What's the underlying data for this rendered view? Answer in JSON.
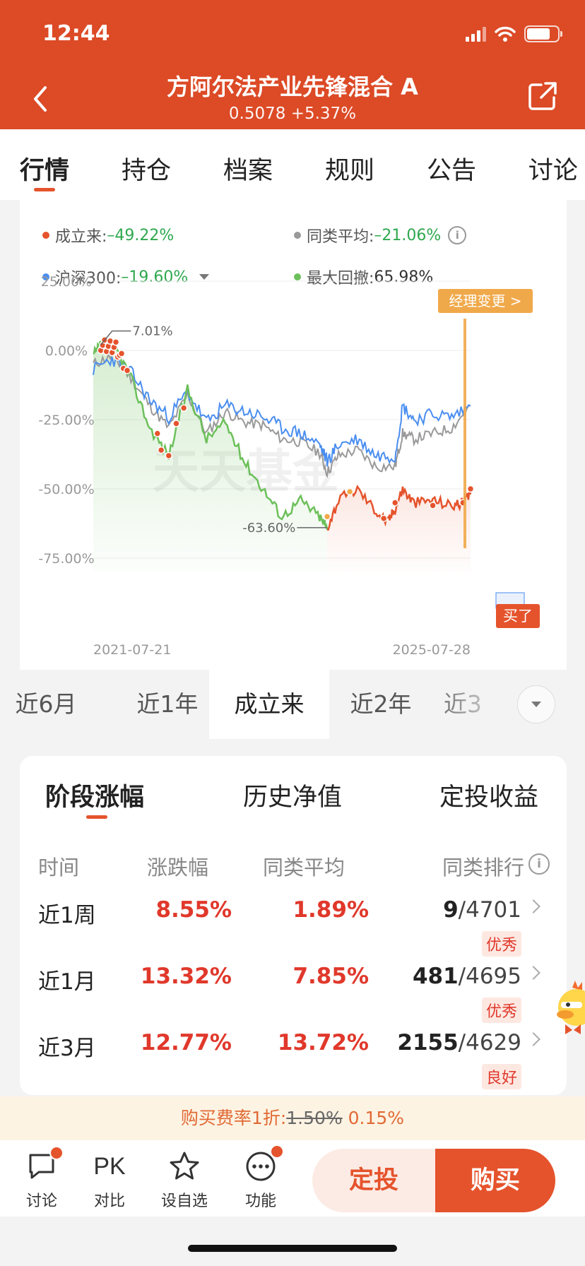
{
  "status_bar": {
    "time": "12:44"
  },
  "header": {
    "title": "方阿尔法产业先锋混合 A",
    "subtitle": "0.5078 +5.37%"
  },
  "tabs": [
    "行情",
    "持仓",
    "档案",
    "规则",
    "公告",
    "讨论"
  ],
  "legend": {
    "fund_label": "成立来:",
    "fund_value": "–49.22%",
    "peer_label": "同类平均:",
    "peer_value": "–21.06%",
    "index_label": "沪深300:",
    "index_value": "–19.60%",
    "drawdown_label": "最大回撤:",
    "drawdown_value": "65.98%",
    "info_icon": "i"
  },
  "colors": {
    "brand": "#dc4a26",
    "fund": "#e5532c",
    "peer": "#999999",
    "index": "#4a8ef0",
    "drawdown": "#6cc05a",
    "manager": "#f0a94a"
  },
  "chart_data": {
    "type": "line",
    "ylim": [
      -75,
      25
    ],
    "yticks": [
      "25.00%",
      "0.00%",
      "-25.00%",
      "-50.00%",
      "-75.00%"
    ],
    "x_range": [
      "2021-07-21",
      "2025-07-28"
    ],
    "series": [
      {
        "name": "成立来",
        "x": [
          0,
          0.02,
          0.06,
          0.1,
          0.15,
          0.2,
          0.25,
          0.3,
          0.35,
          0.4,
          0.45,
          0.5,
          0.55,
          0.6,
          0.62,
          0.65,
          0.7,
          0.75,
          0.78,
          0.8,
          0.82,
          0.85,
          0.9,
          0.95,
          0.98,
          1.0
        ],
        "values": [
          -2,
          2,
          1,
          -10,
          -28,
          -38,
          -14,
          -32,
          -26,
          -40,
          -50,
          -60,
          -54,
          -60,
          -64,
          -54,
          -50,
          -58,
          -62,
          -57,
          -50,
          -55,
          -54,
          -56,
          -55,
          -52
        ]
      },
      {
        "name": "同类平均",
        "x": [
          0,
          0.05,
          0.1,
          0.15,
          0.2,
          0.25,
          0.3,
          0.35,
          0.4,
          0.45,
          0.5,
          0.55,
          0.6,
          0.62,
          0.65,
          0.7,
          0.75,
          0.8,
          0.82,
          0.85,
          0.9,
          0.95,
          1.0
        ],
        "values": [
          -5,
          -2,
          -10,
          -20,
          -28,
          -16,
          -30,
          -22,
          -26,
          -27,
          -32,
          -33,
          -37,
          -44,
          -38,
          -36,
          -42,
          -42,
          -30,
          -32,
          -30,
          -28,
          -20
        ]
      },
      {
        "name": "沪深300",
        "x": [
          0,
          0.05,
          0.1,
          0.15,
          0.2,
          0.25,
          0.3,
          0.35,
          0.4,
          0.45,
          0.5,
          0.55,
          0.6,
          0.62,
          0.65,
          0.7,
          0.75,
          0.8,
          0.82,
          0.85,
          0.9,
          0.95,
          1.0
        ],
        "values": [
          -7,
          -3,
          -8,
          -18,
          -24,
          -15,
          -26,
          -20,
          -22,
          -24,
          -28,
          -30,
          -34,
          -40,
          -34,
          -32,
          -38,
          -38,
          -20,
          -25,
          -23,
          -24,
          -20
        ]
      }
    ],
    "annotations": [
      {
        "label": "7.01%",
        "series": "成立来"
      },
      {
        "label": "-63.60%",
        "series": "成立来"
      }
    ],
    "manager_tag": "经理变更 >",
    "buy_tag": "买了",
    "watermark": "天天基金"
  },
  "periods": [
    "近6月",
    "近1年",
    "成立来",
    "近2年",
    "近3"
  ],
  "returns": {
    "sub_tabs": [
      "阶段涨幅",
      "历史净值",
      "定投收益"
    ],
    "headers": [
      "时间",
      "涨跌幅",
      "同类平均",
      "同类排行"
    ],
    "rows": [
      {
        "period": "近1周",
        "change": "8.55%",
        "avg": "1.89%",
        "rank": "9",
        "total": "/4701",
        "badge": "优秀"
      },
      {
        "period": "近1月",
        "change": "13.32%",
        "avg": "7.85%",
        "rank": "481",
        "total": "/4695",
        "badge": "优秀"
      },
      {
        "period": "近3月",
        "change": "12.77%",
        "avg": "13.72%",
        "rank": "2155",
        "total": "/4629",
        "badge": "良好"
      }
    ]
  },
  "fee": {
    "prefix": "购买费率1折:",
    "original": "1.50%",
    "discounted": "0.15%"
  },
  "toolbar": {
    "discuss": "讨论",
    "pk_icon": "PK",
    "compare": "对比",
    "watchlist": "设自选",
    "functions": "功能",
    "sip": "定投",
    "buy": "购买"
  }
}
